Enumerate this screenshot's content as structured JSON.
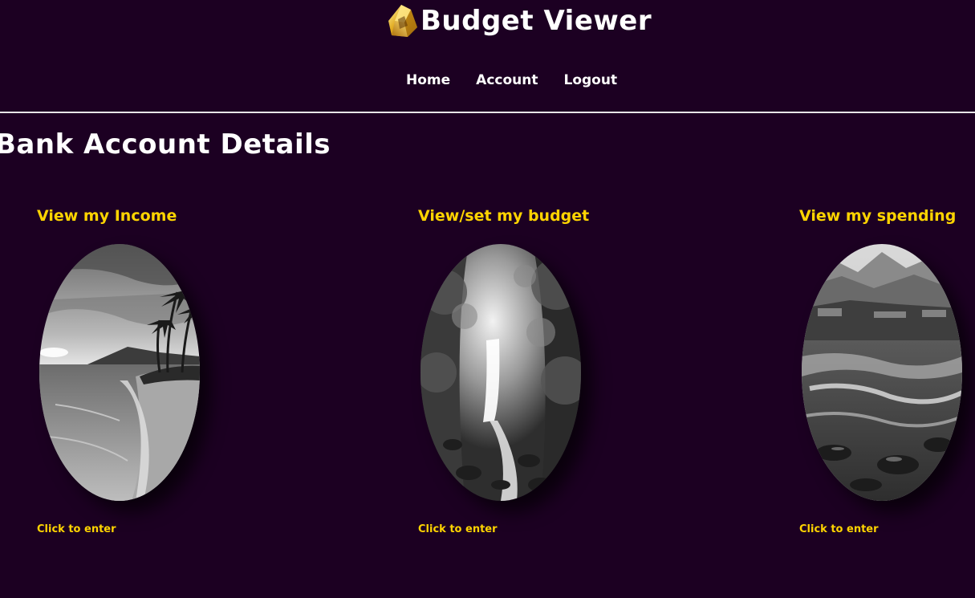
{
  "header": {
    "title": "Budget Viewer",
    "logo_icon": "gold-gem-icon"
  },
  "nav": {
    "items": [
      {
        "label": "Home"
      },
      {
        "label": "Account"
      },
      {
        "label": "Logout"
      }
    ]
  },
  "main": {
    "title": "Bank Account Details",
    "cards": [
      {
        "title": "View my Income",
        "link_label": "Click to enter",
        "image": "beach-palm-trees-photo"
      },
      {
        "title": "View/set my budget",
        "link_label": "Click to enter",
        "image": "forest-waterfall-photo"
      },
      {
        "title": "View my spending",
        "link_label": "Click to enter",
        "image": "mountain-river-rapids-photo"
      }
    ]
  },
  "colors": {
    "background": "#1c0022",
    "accent": "#ffd400",
    "text": "#ffffff",
    "divider": "#e6e6e6"
  }
}
